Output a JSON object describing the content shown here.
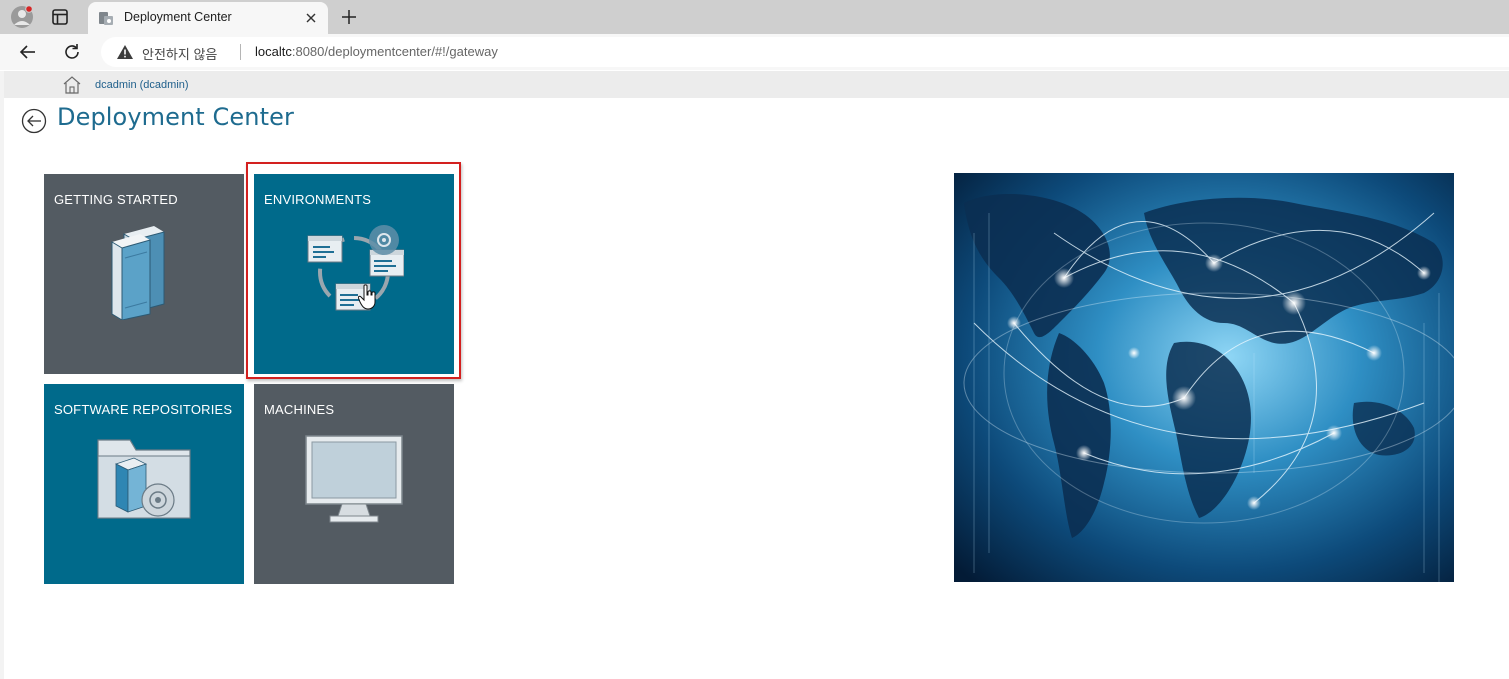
{
  "browser": {
    "tab_title": "Deployment Center",
    "security_label": "안전하지 않음",
    "url_host": "localtc",
    "url_rest": ":8080/deploymentcenter/#!/gateway"
  },
  "app_bar": {
    "user_label": "dcadmin (dcadmin)"
  },
  "page": {
    "title": "Deployment Center"
  },
  "tiles": [
    {
      "label": "GETTING STARTED",
      "color": "#535b62",
      "icon": "books-icon"
    },
    {
      "label": "ENVIRONMENTS",
      "color": "#006a8b",
      "icon": "environments-icon",
      "highlighted": true
    },
    {
      "label": "SOFTWARE REPOSITORIES",
      "color": "#006a8b",
      "icon": "software-repository-icon"
    },
    {
      "label": "MACHINES",
      "color": "#535b62",
      "icon": "monitor-icon"
    }
  ],
  "colors": {
    "accent": "#1e6b8f",
    "highlight": "#d3201f"
  }
}
